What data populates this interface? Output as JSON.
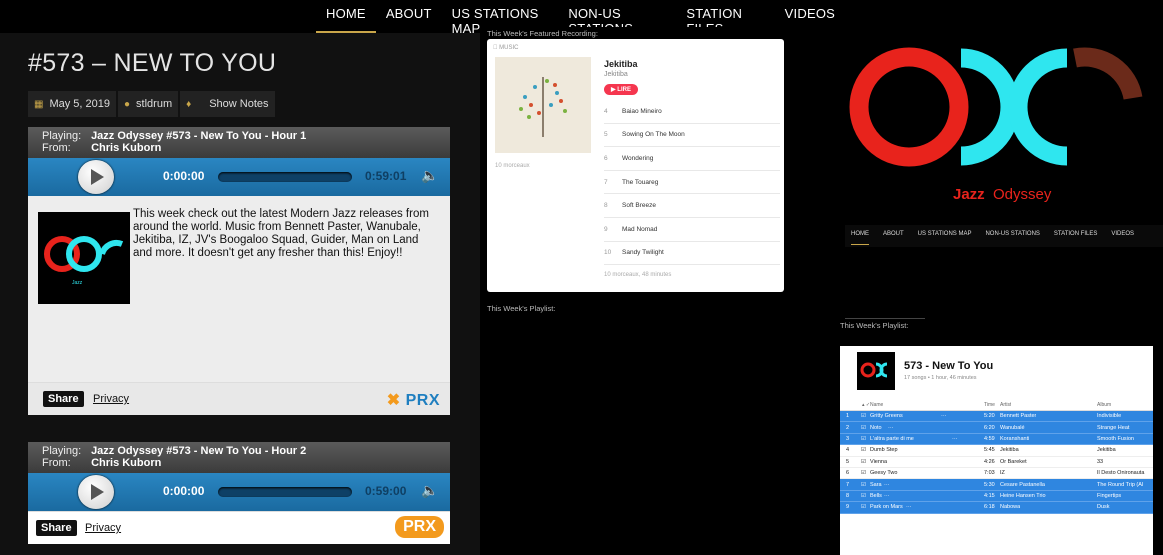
{
  "nav": {
    "items": [
      "HOME",
      "ABOUT",
      "US STATIONS MAP",
      "NON-US STATIONS",
      "STATION FILES",
      "VIDEOS"
    ],
    "active": "HOME"
  },
  "post": {
    "title": "#573 – NEW TO YOU",
    "date": "May 5, 2019",
    "author": "stldrum",
    "category": "Show Notes"
  },
  "players": [
    {
      "playing_label": "Playing:",
      "playing_value": "Jazz Odyssey #573 - New To You - Hour 1",
      "from_label": "From:",
      "from_value": "Chris Kuborn",
      "time_current": "0:00:00",
      "time_total": "0:59:01",
      "description": "This week check out the latest Modern Jazz releases from around the world. Music from Bennett Paster, Wanubale, Jekitiba, IZ, JV's Boogaloo Squad, Guider, Man on Land and more. It doesn't get any fresher than this! Enjoy!!",
      "share": "Share",
      "privacy": "Privacy",
      "prx": "PRX"
    },
    {
      "playing_label": "Playing:",
      "playing_value": "Jazz Odyssey #573 - New To You - Hour 2",
      "from_label": "From:",
      "from_value": "Chris Kuborn",
      "time_current": "0:00:00",
      "time_total": "0:59:00",
      "share": "Share",
      "privacy": "Privacy",
      "prx": "PRX"
    }
  ],
  "logo": {
    "text_a": "Jazz",
    "text_b": "Odyssey",
    "left_color": "#e8231c",
    "mid_color": "#2fe6ef",
    "right_color": "#6b2a1a"
  },
  "featured": {
    "caption": "This Week's Featured Recording:",
    "brand": "MUSIC",
    "album": "Jekitiba",
    "artist": "Jekitiba",
    "listen": "LIRE",
    "count": "10 morceaux",
    "footer": "10 morceaux, 48 minutes",
    "tracks": [
      {
        "n": "4",
        "title": "Baiao Mineiro"
      },
      {
        "n": "5",
        "title": "Sowing On The Moon"
      },
      {
        "n": "6",
        "title": "Wondering"
      },
      {
        "n": "7",
        "title": "The Touareg"
      },
      {
        "n": "8",
        "title": "Soft Breeze"
      },
      {
        "n": "9",
        "title": "Mad Nomad"
      },
      {
        "n": "10",
        "title": "Sandy Twilight"
      }
    ]
  },
  "playlist_caption": "This Week's Playlist:",
  "right_nav": [
    "HOME",
    "ABOUT",
    "US STATIONS MAP",
    "NON-US STATIONS",
    "STATION FILES",
    "VIDEOS"
  ],
  "playlist": {
    "title": "573 - New To You",
    "subtitle": "17 songs • 1 hour, 46 minutes",
    "headers": {
      "name": "Name",
      "time": "Time",
      "artist": "Artist",
      "album": "Album"
    },
    "rows": [
      {
        "n": "1",
        "name": "Gritty Greens",
        "time": "5:20",
        "artist": "Bennett Paster",
        "album": "Indivisible",
        "sel": true
      },
      {
        "n": "2",
        "name": "Noto",
        "time": "6:20",
        "artist": "Wanubalé",
        "album": "Strange Heat",
        "sel": true
      },
      {
        "n": "3",
        "name": "L'altra parte di me",
        "time": "4:59",
        "artist": "Koranshanti",
        "album": "Smooth Fusion",
        "sel": true
      },
      {
        "n": "4",
        "name": "Dumb Step",
        "time": "5:45",
        "artist": "Jekitiba",
        "album": "Jekitiba",
        "sel": false
      },
      {
        "n": "5",
        "name": "Vienna",
        "time": "4:26",
        "artist": "Or Bareket",
        "album": "33",
        "sel": false
      },
      {
        "n": "6",
        "name": "Geesy Two",
        "time": "7:03",
        "artist": "IZ",
        "album": "Il Desto Onironauta",
        "sel": false
      },
      {
        "n": "7",
        "name": "Sara",
        "time": "5:30",
        "artist": "Cesare Pastanella",
        "album": "The Round Trip (Al",
        "sel": true
      },
      {
        "n": "8",
        "name": "Bells",
        "time": "4:15",
        "artist": "Heine Hansen Trio",
        "album": "Fingertips",
        "sel": true
      },
      {
        "n": "9",
        "name": "Park on Mars",
        "time": "6:18",
        "artist": "Nabowa",
        "album": "Dusk",
        "sel": true
      }
    ]
  }
}
